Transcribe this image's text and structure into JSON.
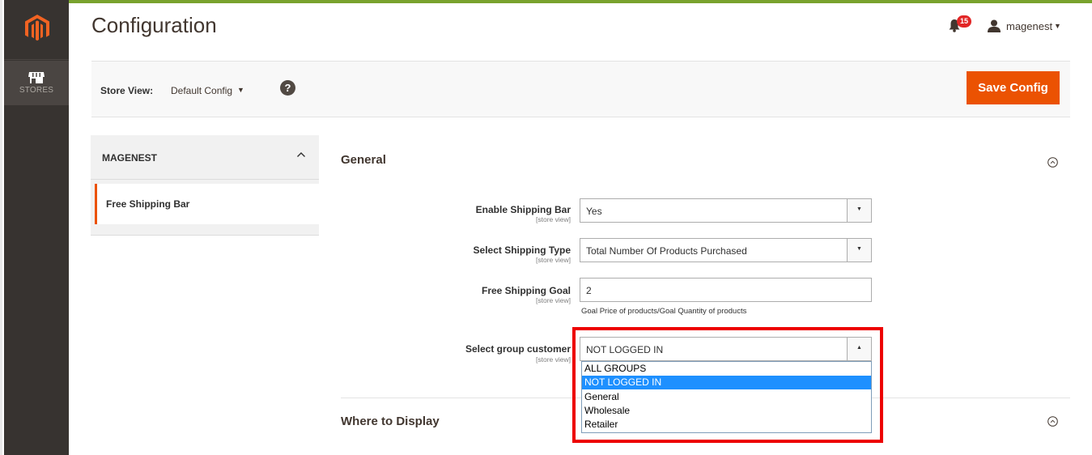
{
  "colors": {
    "sidebar": "#373330",
    "accent": "#eb5202",
    "highlight": "#ed0000",
    "selected_option": "#1e90ff"
  },
  "nav": {
    "stores_label": "STORES"
  },
  "header": {
    "title": "Configuration",
    "notification_count": "15",
    "user_name": "magenest"
  },
  "toolbar": {
    "store_view_label": "Store View:",
    "store_view_value": "Default Config",
    "help_glyph": "?",
    "save_label": "Save Config"
  },
  "sidebar_panel": {
    "group_title": "MAGENEST",
    "items": [
      {
        "label": "Free Shipping Bar"
      }
    ]
  },
  "sections": {
    "general_title": "General",
    "where_title": "Where to Display"
  },
  "fields": [
    {
      "label": "Enable Shipping Bar",
      "scope": "[store view]",
      "value": "Yes"
    },
    {
      "label": "Select Shipping Type",
      "scope": "[store view]",
      "value": "Total Number Of Products Purchased"
    },
    {
      "label": "Free Shipping Goal",
      "scope": "[store view]",
      "value": "2",
      "hint": "Goal Price of products/Goal Quantity of products"
    },
    {
      "label": "Select group customer",
      "scope": "[store view]",
      "value": "NOT LOGGED IN",
      "options": [
        "ALL GROUPS",
        "NOT LOGGED IN",
        "General",
        "Wholesale",
        "Retailer"
      ]
    }
  ]
}
